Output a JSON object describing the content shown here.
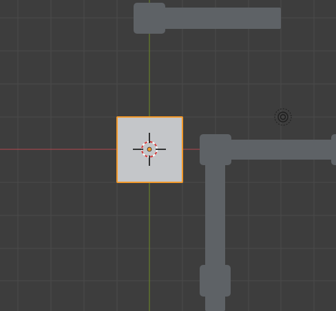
{
  "viewport": {
    "view": "top-orthographic",
    "grid": true,
    "colors": {
      "background": "#3d3d3d",
      "grid_line": "#4a4a4a",
      "x_axis": "#b5484f",
      "y_axis": "#6e8d27",
      "object": "#5e6266",
      "selected_object": "#c4c6c9",
      "selection_outline": "#f39a2b",
      "cursor_ring_red": "#d43b3b",
      "cursor_ring_white": "#ffffff",
      "origin_dot": "#f39a2b",
      "light_icon": "#1e1e1e"
    }
  },
  "scene": {
    "objects": [
      {
        "name": "pipe-top-horizontal",
        "selected": false
      },
      {
        "name": "pipe-top-joint",
        "selected": false
      },
      {
        "name": "selected-cube",
        "selected": true
      },
      {
        "name": "pipe-right-horizontal",
        "selected": false
      },
      {
        "name": "pipe-elbow-joint",
        "selected": false
      },
      {
        "name": "pipe-vertical",
        "selected": false
      },
      {
        "name": "pipe-bottom-joint",
        "selected": false
      },
      {
        "name": "pipe-right-end-cap",
        "selected": false
      }
    ],
    "light": {
      "icon": "light-icon"
    },
    "cursor": {
      "icon": "3d-cursor-icon"
    }
  }
}
